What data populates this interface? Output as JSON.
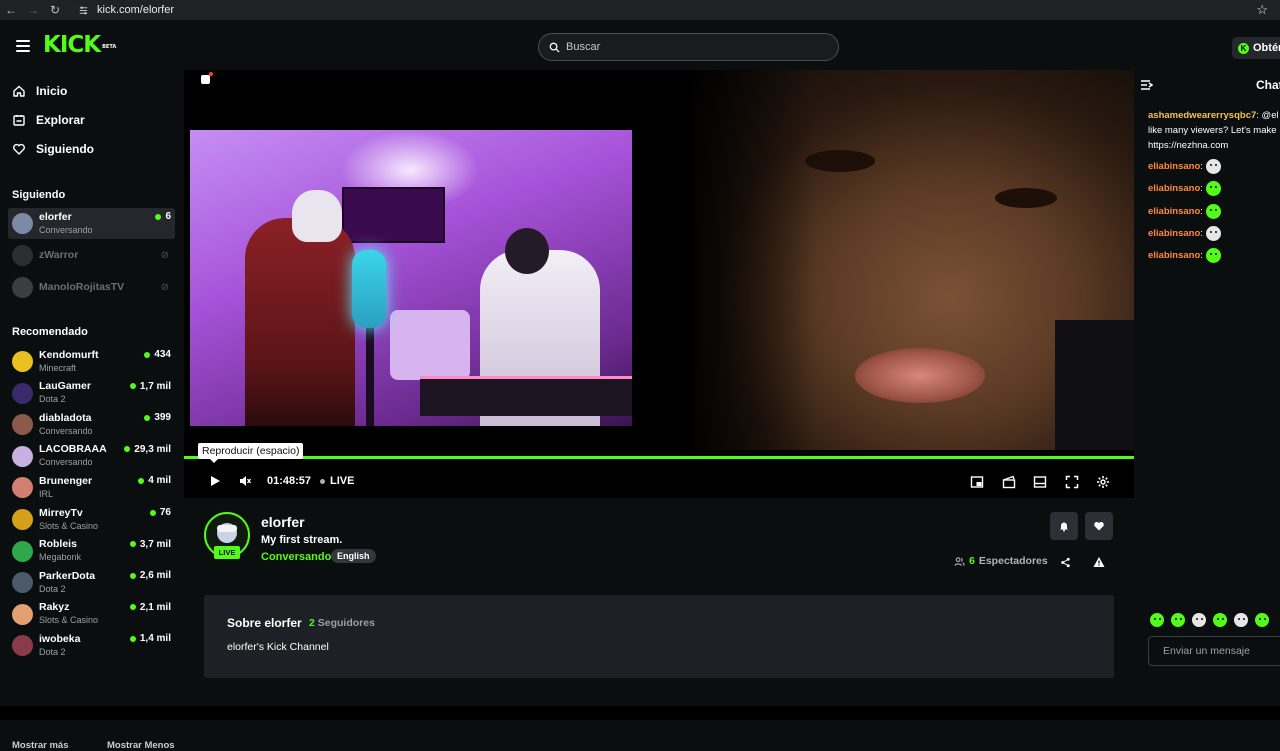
{
  "browser": {
    "url": "kick.com/elorfer"
  },
  "header": {
    "logo": "KICK",
    "logo_badge": "BETA",
    "search_placeholder": "Buscar",
    "get_button": "Obtén"
  },
  "sidebar": {
    "nav": [
      {
        "label": "Inicio",
        "icon": "home-icon"
      },
      {
        "label": "Explorar",
        "icon": "compass-icon"
      },
      {
        "label": "Siguiendo",
        "icon": "heart-icon"
      }
    ],
    "following_title": "Siguiendo",
    "following": [
      {
        "name": "elorfer",
        "sub": "Conversando",
        "viewers": "6",
        "live": true,
        "color": "#7c8aa6"
      },
      {
        "name": "zWarror",
        "sub": "",
        "viewers": "",
        "live": false,
        "color": "#555"
      },
      {
        "name": "ManoloRojitasTV",
        "sub": "",
        "viewers": "",
        "live": false,
        "color": "#777"
      }
    ],
    "recommended_title": "Recomendado",
    "recommended": [
      {
        "name": "Kendomurft",
        "sub": "Minecraft",
        "viewers": "434",
        "color": "#e8c020"
      },
      {
        "name": "LauGamer",
        "sub": "Dota 2",
        "viewers": "1,7 mil",
        "color": "#3a2a6a"
      },
      {
        "name": "diabladota",
        "sub": "Conversando",
        "viewers": "399",
        "color": "#8a5a4a"
      },
      {
        "name": "LACOBRAAA",
        "sub": "Conversando",
        "viewers": "29,3 mil",
        "color": "#c8b0e0"
      },
      {
        "name": "Brunenger",
        "sub": "IRL",
        "viewers": "4 mil",
        "color": "#d08070"
      },
      {
        "name": "MirreyTv",
        "sub": "Slots & Casino",
        "viewers": "76",
        "color": "#d4a017"
      },
      {
        "name": "Robleis",
        "sub": "Megabonk",
        "viewers": "3,7 mil",
        "color": "#2ea84a"
      },
      {
        "name": "ParkerDota",
        "sub": "Dota 2",
        "viewers": "2,6 mil",
        "color": "#4a5a6a"
      },
      {
        "name": "Rakyz",
        "sub": "Slots & Casino",
        "viewers": "2,1 mil",
        "color": "#e0a070"
      },
      {
        "name": "iwobeka",
        "sub": "Dota 2",
        "viewers": "1,4 mil",
        "color": "#8a3a4a"
      }
    ],
    "show_more": "Mostrar más",
    "show_less": "Mostrar Menos"
  },
  "player": {
    "tooltip": "Reproducir (espacio)",
    "time": "01:48:57",
    "live_label": "LIVE",
    "progress": 1.0
  },
  "streamer": {
    "name": "elorfer",
    "title": "My first stream.",
    "category": "Conversando",
    "language": "English",
    "live_badge": "LIVE",
    "viewers_count": "6",
    "viewers_label": "Espectadores"
  },
  "about": {
    "title": "Sobre elorfer",
    "followers_count": "2",
    "followers_label": "Seguidores",
    "description": "elorfer's Kick Channel"
  },
  "chat": {
    "title": "Chat",
    "messages": [
      {
        "user": "ashamedwearerrysqbc7",
        "line1": ": @el",
        "line2": "like many viewers? Let's make",
        "line3": "https://nezhna.com"
      },
      {
        "user": "eliabinsano",
        "emote": "skull"
      },
      {
        "user": "eliabinsano",
        "emote": "green"
      },
      {
        "user": "eliabinsano",
        "emote": "green"
      },
      {
        "user": "eliabinsano",
        "emote": "skull"
      },
      {
        "user": "eliabinsano",
        "emote": "green"
      }
    ],
    "input_placeholder": "Enviar un mensaje"
  },
  "colors": {
    "accent": "#53fc18",
    "background": "#0b0e0f",
    "panel": "#1d2024"
  }
}
